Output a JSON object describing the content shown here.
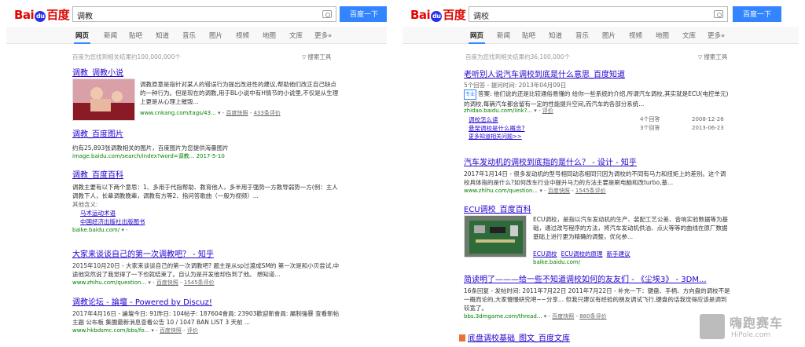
{
  "left": {
    "logo": {
      "bai": "Bai",
      "paw": "du",
      "cn": "百度"
    },
    "search": {
      "query": "调教",
      "button": "百度一下"
    },
    "tabs": [
      "网页",
      "新闻",
      "贴吧",
      "知道",
      "音乐",
      "图片",
      "视频",
      "地图",
      "文库",
      "更多»"
    ],
    "result_count": "百度为您找到相关结果约100,000,000个",
    "tools": "搜索工具",
    "results": [
      {
        "title": "调教_调教小说",
        "abstract": "调教原意是指针对某人的错误行为提出改进性的建议,帮助他们改正自己缺点的一种行为。但是现在的调教,用于BL小说中有H情节的小说里,不仅是从生理上更是从心理上摧毁...",
        "url": "www.cnkang.com/tags/43...",
        "snapshot": "百度快照",
        "reviews": "433条评价"
      },
      {
        "title": "调教_百度图片",
        "abstract": "约有25,893张调教相关的图片，百度图片为您提供海量图片",
        "url": "image.baidu.com/search/index?word=调教... 2017-5-10"
      },
      {
        "title": "调教_百度百科",
        "abstract": "调教主要有以下两个意思：1、多用于代指帮助、教育他人，多半用于强势一方教导弱势一方(例：主人调教下人，长辈调教晚辈，调教有方等2、指问答歌曲（一般为视频）...",
        "extra_label": "其他含义:",
        "sublinks": [
          "马术运动术语",
          "中国经济出版社出版图书"
        ],
        "url": "baike.baidu.com/"
      },
      {
        "title": "大家来谈谈自己的第一次调教吧？ - 知乎",
        "abstract": "2015年10月20日 - 大家来谈谈自己的第一次调教吧? 题主是从sp过渡成SM的 第一次是和小贝尝试,中途他突然说了我觉得了一下也就结束了。自认为是开发他却伤到了他。 想知道...",
        "url": "www.zhihu.com/question...",
        "snapshot": "百度快照",
        "reviews": "1545条评价"
      },
      {
        "title": "调教论坛 - 論壇 - Powered by Discuz!",
        "abstract": "2017年4月16日 - 論壇今日: 91昨日: 104帖子: 187604會員: 23903歡迎新會員: 屬制強暴 查看新帖主題 公布板 集團最新消息查看公告 10 / 1047 BAN LIST 3 天前 ...",
        "url": "www.hkbdsmc.com/bbs/fo...",
        "snapshot": "百度快照",
        "reviews": "评价"
      }
    ]
  },
  "right": {
    "logo": {
      "bai": "Bai",
      "paw": "du",
      "cn": "百度"
    },
    "search": {
      "query": "调校",
      "button": "百度一下"
    },
    "tabs": [
      "网页",
      "新闻",
      "贴吧",
      "知道",
      "音乐",
      "图片",
      "视频",
      "地图",
      "文库",
      "更多»"
    ],
    "result_count": "百度为您找到相关结果约36,100,000个",
    "tools": "搜索工具",
    "results": [
      {
        "title": "老听别人说汽车调校到底是什么意思_百度知道",
        "meta": "5个回答 - 提问时间: 2013年04月09日",
        "tag": "专业",
        "abstract": "答案: 他们说的还是比较通俗易懂的 给你一些系统的介绍,所谓汽车调校,其实就是ECU(电控单元)的调校,每辆汽车都会留有一定的性能提升空间,而汽车的各部分系统...",
        "url": "zhidao.baidu.com/link?...",
        "reviews": "评价",
        "qa": [
          {
            "q": "调校怎么读",
            "answers": "4个回答",
            "date": "2008-12-26"
          },
          {
            "q": "悬架调校是什么概念?",
            "answers": "3个回答",
            "date": "2013-06-23"
          }
        ],
        "more": "更多知道相关问题>>"
      },
      {
        "title": "汽车发动机的调校到底指的是什么？ - 设计 - 知乎",
        "abstract": "2017年1月14日 - 很多发动机的型号相同动态相同只因为调校的不同有马力和扭矩上的差别。这个调校具体指的是什么?如何改车行业中提升马力的方法主要是刷电脑和改turbo,基...",
        "url": "www.zhihu.com/question...",
        "snapshot": "百度快照",
        "reviews": "1545条评价"
      },
      {
        "title": "ECU调校_百度百科",
        "abstract": "ECU调校，是指以汽车发动机的生产、装配工艺公差、音响实验数据等为基础，通过改写程序的方法，将汽车发动机供油、点火等等的曲线在原厂数据基础上进行更为精确的调整，优化参...",
        "sublinks": [
          "ECU调校",
          "ECU调校的原理",
          "新手建议"
        ],
        "url": "baike.baidu.com/"
      },
      {
        "title": "简读明了———给一些不知道调校如何的友友们 - 《尘埃3》 - 3DM...",
        "abstract": "16条回复 - 发帖时间: 2011年7月22日 2011年7月22日 - 补充一下：键盘、手柄、方向盘的调校不是一概而论的,大家慢慢研究吧~~分享... 但我只建议有经验的朋友调试飞行,键盘的话我觉得应该是调到较宽了。",
        "url": "bbs.3dmgame.com/thread...",
        "snapshot": "百度快照",
        "reviews": "880条评价"
      },
      {
        "title": "底盘调校基础_图文_百度文库"
      }
    ],
    "watermark": {
      "brand": "嗨跑赛车",
      "site": "HiPole.com"
    }
  }
}
